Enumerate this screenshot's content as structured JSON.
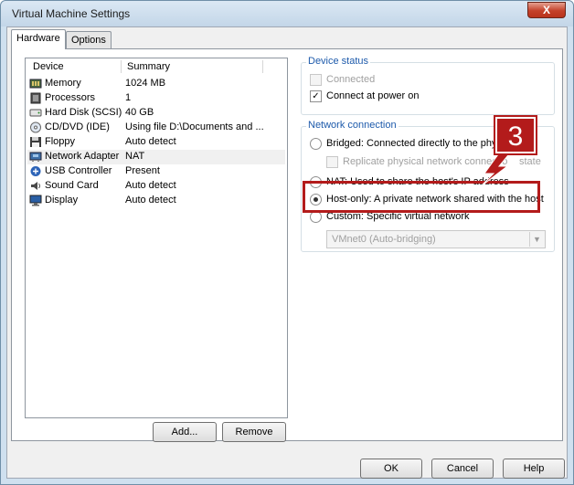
{
  "window": {
    "title": "Virtual Machine Settings",
    "close_glyph": "X"
  },
  "tabs": [
    {
      "label": "Hardware",
      "active": true
    },
    {
      "label": "Options",
      "active": false
    }
  ],
  "device_list": {
    "columns": [
      "Device",
      "Summary"
    ],
    "rows": [
      {
        "device": "Memory",
        "summary": "1024 MB",
        "icon": "memory-icon"
      },
      {
        "device": "Processors",
        "summary": "1",
        "icon": "processor-icon"
      },
      {
        "device": "Hard Disk (SCSI)",
        "summary": "40 GB",
        "icon": "hard-disk-icon"
      },
      {
        "device": "CD/DVD (IDE)",
        "summary": "Using file D:\\Documents and ...",
        "icon": "cd-dvd-icon"
      },
      {
        "device": "Floppy",
        "summary": "Auto detect",
        "icon": "floppy-icon"
      },
      {
        "device": "Network Adapter",
        "summary": "NAT",
        "icon": "network-adapter-icon",
        "selected": true
      },
      {
        "device": "USB Controller",
        "summary": "Present",
        "icon": "usb-icon"
      },
      {
        "device": "Sound Card",
        "summary": "Auto detect",
        "icon": "sound-card-icon"
      },
      {
        "device": "Display",
        "summary": "Auto detect",
        "icon": "display-icon"
      }
    ]
  },
  "list_buttons": {
    "add": "Add...",
    "remove": "Remove"
  },
  "device_status": {
    "title": "Device status",
    "connected_label": "Connected",
    "connected_checked": false,
    "connected_enabled": false,
    "connect_power_on_label": "Connect at power on",
    "connect_power_on_checked": true
  },
  "network_connection": {
    "title": "Network connection",
    "bridged_label": "Bridged: Connected directly to the physic",
    "replicate_label": "Replicate physical network connectio",
    "replicate_suffix": "state",
    "nat_label": "NAT: Used to share the host's IP address",
    "host_only_label": "Host-only: A private network shared with the host",
    "custom_label": "Custom: Specific virtual network",
    "selected": "host-only",
    "vmnet_value": "VMnet0 (Auto-bridging)"
  },
  "callout": {
    "number": "3"
  },
  "dialog_buttons": {
    "ok": "OK",
    "cancel": "Cancel",
    "help": "Help"
  },
  "colors": {
    "accent_group_title": "#1d5aab",
    "callout_red": "#b31b1b",
    "close_red": "#c4412a"
  }
}
